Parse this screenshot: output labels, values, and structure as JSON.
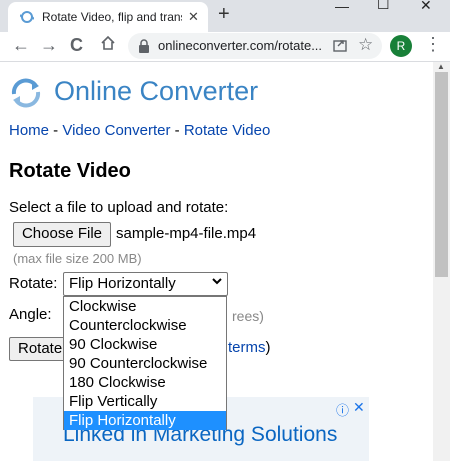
{
  "browser": {
    "tab_title": "Rotate Video, flip and transpo",
    "tab_close": "✕",
    "new_tab": "+",
    "window": {
      "minimize": "—",
      "maximize": "☐",
      "close": "✕"
    },
    "back": "←",
    "forward": "→",
    "reload": "C",
    "url": "onlineconverter.com/rotate...",
    "star": "☆",
    "profile_initial": "R",
    "menu": "⋮"
  },
  "site": {
    "logo_text": "Online Converter"
  },
  "breadcrumb": {
    "home": "Home",
    "sep1": " - ",
    "video_converter": "Video Converter",
    "sep2": " - ",
    "rotate_video": "Rotate Video"
  },
  "page": {
    "title": "Rotate Video",
    "prompt": "Select a file to upload and rotate:",
    "choose_file": "Choose File",
    "file_name": "sample-mp4-file.mp4",
    "max_size": "(max file size 200 MB)",
    "rotate_label": "Rotate:",
    "rotate_selected": "Flip Horizontally",
    "angle_label": "Angle:",
    "degrees_text": "rees)",
    "rotate_button": "Rotate",
    "terms_link": "terms",
    "terms_close": ")"
  },
  "dropdown": {
    "options": [
      "Clockwise",
      "Counterclockwise",
      "90 Clockwise",
      "90 Counterclockwise",
      "180 Clockwise",
      "Flip Vertically",
      "Flip Horizontally"
    ],
    "selected_index": 6
  },
  "ad": {
    "text": "Linked in Marketing Solutions",
    "info": "ⓘ",
    "close": "✕"
  },
  "colors": {
    "accent": "#1e90ff",
    "logo": "#3a84c4",
    "link": "#0645ad"
  }
}
